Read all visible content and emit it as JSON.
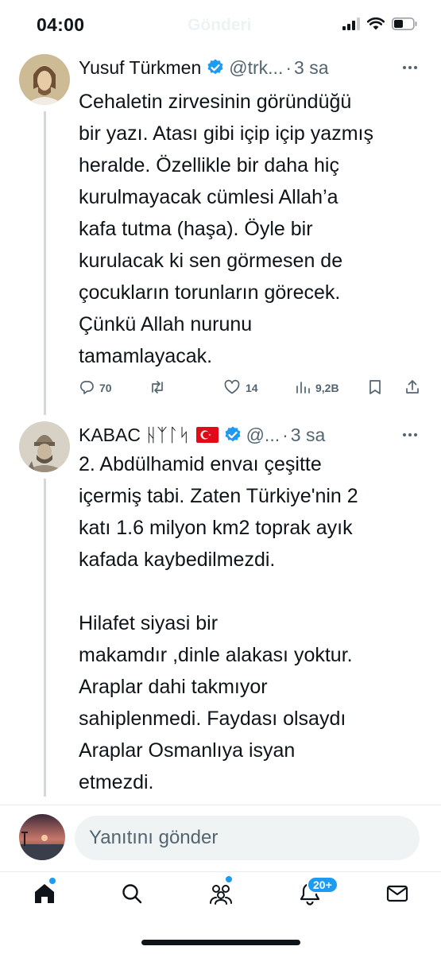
{
  "status_bar": {
    "time": "04:00",
    "ghost_title": "Gönderi"
  },
  "tweets": [
    {
      "display_name": "Yusuf Türkmen",
      "handle": "@trk...",
      "time": "3 sa",
      "text": "Cehaletin zirvesinin göründüğü\nbir yazı. Atası gibi içip içip yazmış\nheralde. Özellikle bir daha hiç\nkurulmayacak cümlesi Allah’a\nkafa tutma (haşa). Öyle bir\nkurulacak ki sen görmesen de\nçocukların torunların görecek.\nÇünkü Allah nurunu\ntamamlayacak.",
      "replies": "70",
      "reposts": "",
      "likes": "14",
      "views": "9,2B"
    },
    {
      "display_name": "KABAC 𐰴𐰀𐰉𐰀𐰲",
      "display_runes": "KABAC ᚺᛉᛚᛋ",
      "handle": "@...",
      "time": "3 sa",
      "text": "2. Abdülhamid envaı çeşitte\niçermiş tabi. Zaten Türkiye'nin 2\nkatı 1.6 milyon km2 toprak ayık\nkafada kaybedilmezdi.\n\nHilafet siyasi bir\nmakamdır ,dinle alakası yoktur.\nAraplar dahi takmıyor\nsahiplenmedi. Faydası olsaydı\nAraplar Osmanlıya isyan\netmezdi."
    }
  ],
  "reply_bar": {
    "placeholder": "Yanıtını gönder"
  },
  "bottom_nav": {
    "notifications_badge": "20+"
  },
  "colors": {
    "accent": "#1d9bf0",
    "text": "#0f1419",
    "secondary": "#536471"
  }
}
